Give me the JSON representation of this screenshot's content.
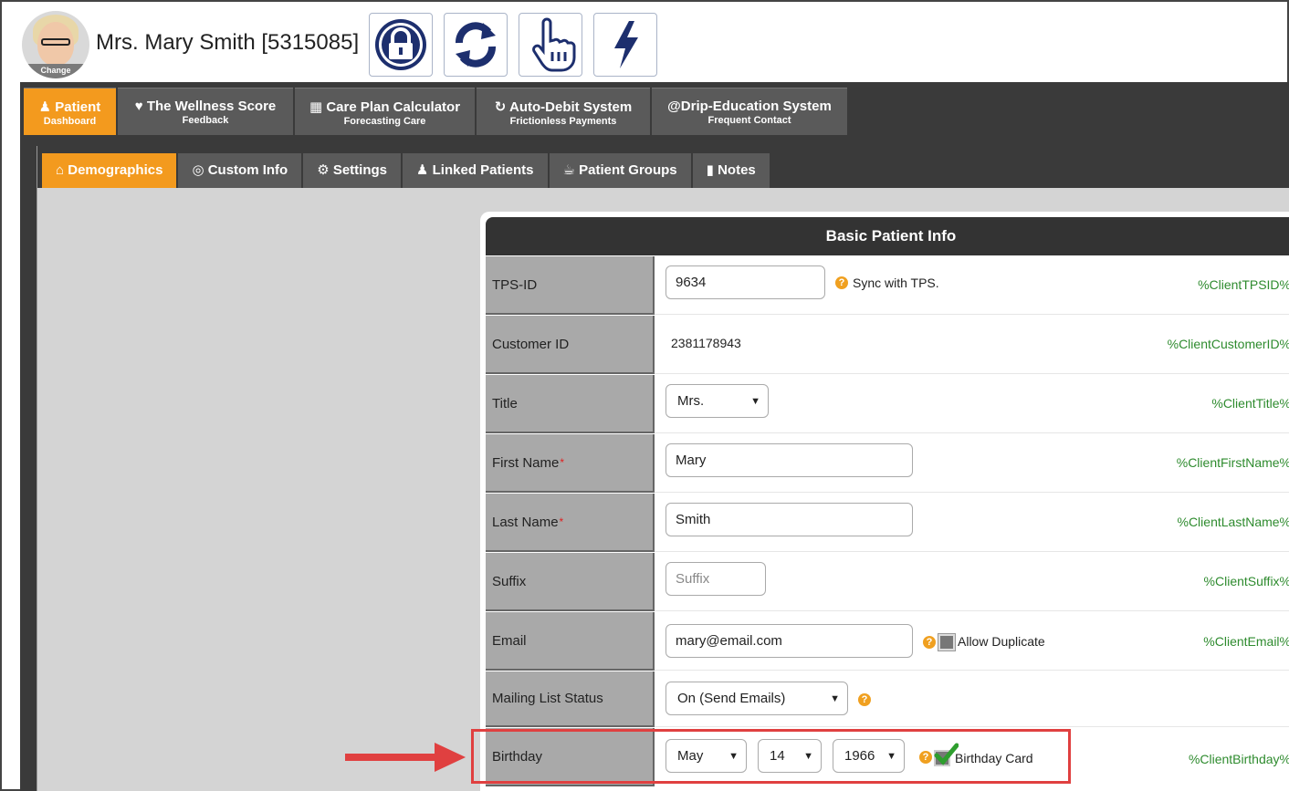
{
  "header": {
    "patient_title": "Mrs. Mary Smith [5315085]",
    "avatar_change_label": "Change",
    "actions": [
      {
        "icon": "lock-icon"
      },
      {
        "icon": "refresh-icon"
      },
      {
        "icon": "pointer-hand-icon"
      },
      {
        "icon": "lightning-icon"
      }
    ]
  },
  "top_tabs": [
    {
      "label": "Patient",
      "sub": "Dashboard",
      "icon": "user-icon"
    },
    {
      "label": "The Wellness Score",
      "sub": "Feedback",
      "icon": "heart-pulse-icon"
    },
    {
      "label": "Care Plan Calculator",
      "sub": "Forecasting Care",
      "icon": "calculator-icon"
    },
    {
      "label": "Auto-Debit System",
      "sub": "Frictionless Payments",
      "icon": "refresh-icon"
    },
    {
      "label": "Drip-Education System",
      "sub": "Frequent Contact",
      "icon": "at-icon"
    }
  ],
  "sub_tabs": [
    {
      "label": "Demographics",
      "icon": "home-icon"
    },
    {
      "label": "Custom Info",
      "icon": "target-icon"
    },
    {
      "label": "Settings",
      "icon": "gear-icon"
    },
    {
      "label": "Linked Patients",
      "icon": "users-icon"
    },
    {
      "label": "Patient Groups",
      "icon": "cup-icon"
    },
    {
      "label": "Notes",
      "icon": "note-icon"
    }
  ],
  "card": {
    "title": "Basic Patient Info",
    "rows": {
      "tps_id": {
        "label": "TPS-ID",
        "value": "9634",
        "help_text": "Sync with TPS.",
        "merge": "%ClientTPSID%"
      },
      "customer_id": {
        "label": "Customer ID",
        "value": "2381178943",
        "merge": "%ClientCustomerID%"
      },
      "title": {
        "label": "Title",
        "value": "Mrs.",
        "merge": "%ClientTitle%"
      },
      "first_name": {
        "label": "First Name",
        "required": "*",
        "value": "Mary",
        "merge": "%ClientFirstName%"
      },
      "last_name": {
        "label": "Last Name",
        "required": "*",
        "value": "Smith",
        "merge": "%ClientLastName%"
      },
      "suffix": {
        "label": "Suffix",
        "placeholder": "Suffix",
        "merge": "%ClientSuffix%"
      },
      "email": {
        "label": "Email",
        "value": "mary@email.com",
        "dup_label": "Allow Duplicate",
        "merge": "%ClientEmail%"
      },
      "mailing": {
        "label": "Mailing List Status",
        "value": "On (Send Emails)"
      },
      "birthday": {
        "label": "Birthday",
        "month": "May",
        "day": "14",
        "year": "1966",
        "card_label": "Birthday Card",
        "merge": "%ClientBirthday%"
      }
    }
  },
  "help_glyph": "?",
  "colors": {
    "accent": "#f39a1e",
    "dark": "#3a3a3a",
    "merge": "#2e8b2e",
    "highlight": "#e04040"
  }
}
